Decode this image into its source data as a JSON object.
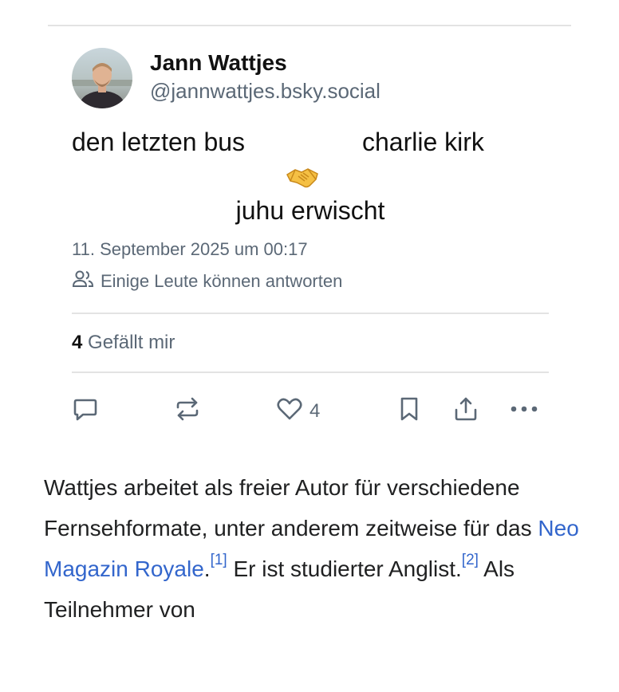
{
  "post": {
    "author_name": "Jann Wattjes",
    "author_handle": "@jannwattjes.bsky.social",
    "text_line1_left": "den letzten bus",
    "text_line1_right": "charlie kirk",
    "emoji": "🤝",
    "text_line3": "juhu erwischt",
    "timestamp": "11. September 2025 um 00:17",
    "reply_permission": "Einige Leute können antworten",
    "likes_count": "4",
    "likes_label": "Gefällt mir",
    "like_button_count": "4",
    "icons": [
      "reply-icon",
      "repost-icon",
      "like-icon",
      "bookmark-icon",
      "share-icon",
      "more-icon",
      "people-icon"
    ]
  },
  "article": {
    "part1": "Wattjes arbeitet als freier Autor für verschiedene Fernsehformate, unter anderem zeitweise für das ",
    "link_text": "Neo Magazin Royale",
    "part2": ".",
    "ref1": "[1]",
    "part3": " Er ist studierter Anglist.",
    "ref2": "[2]",
    "part4": " Als Teilnehmer von"
  },
  "colors": {
    "muted_text": "#5b6876",
    "link": "#3366cc",
    "divider": "#e3e3e3"
  }
}
